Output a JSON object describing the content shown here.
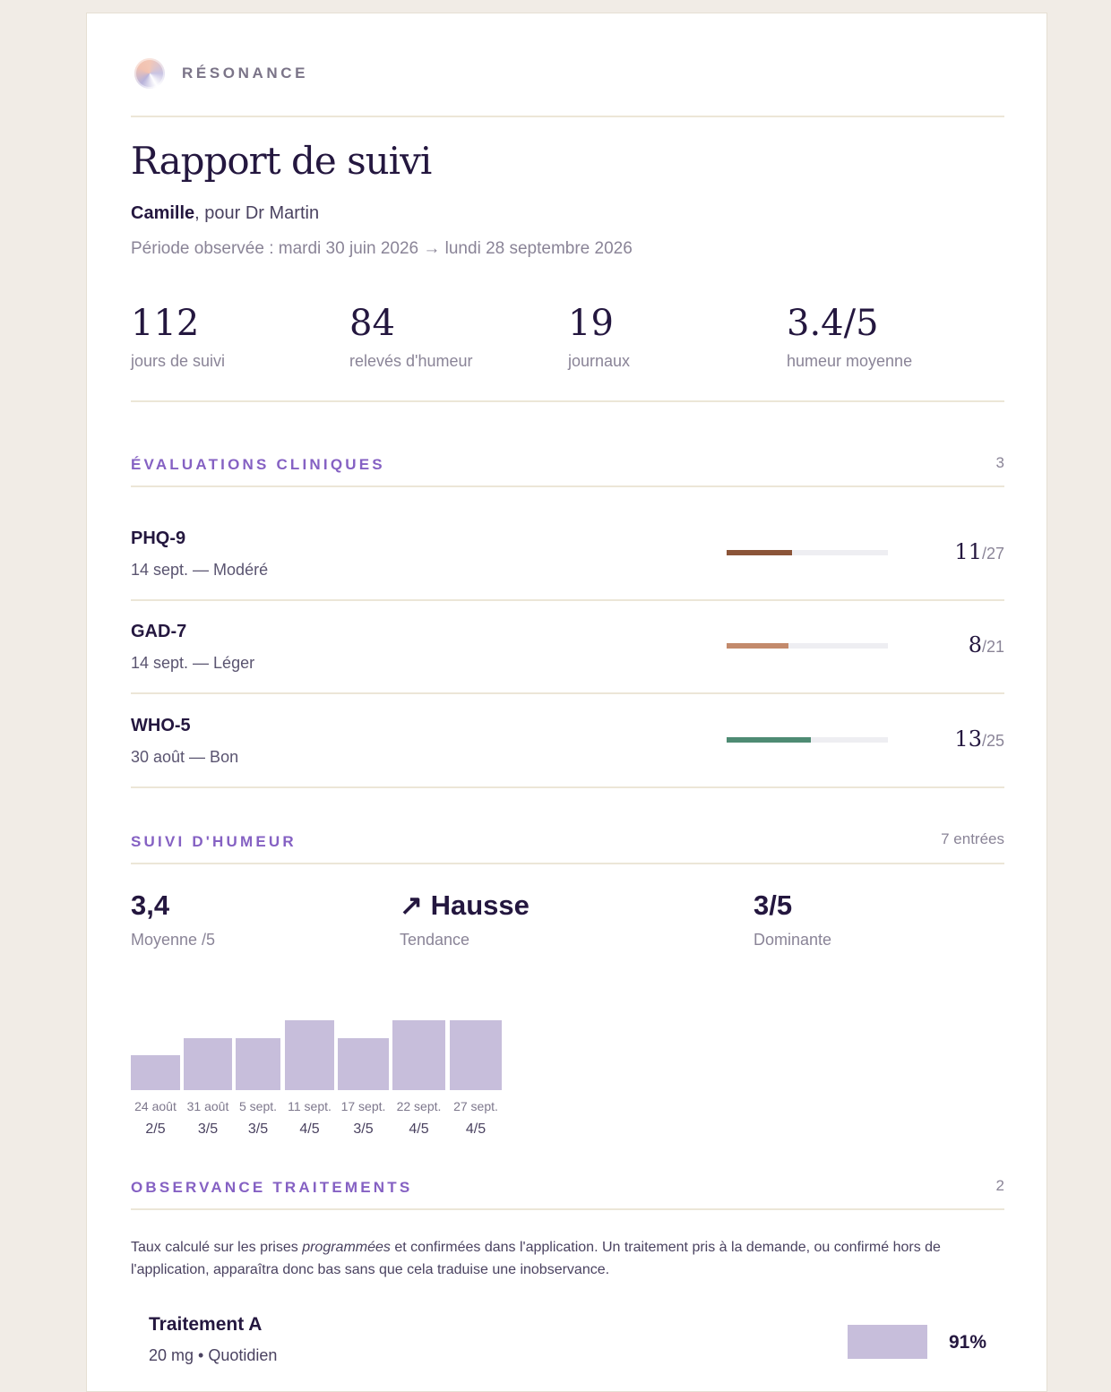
{
  "brand": {
    "name": "RÉSONANCE",
    "logo_icon": "orb-logo-icon"
  },
  "report": {
    "title": "Rapport de suivi",
    "patient": "Camille",
    "for": ", pour Dr Martin",
    "period": "Période observée : mardi 30 juin 2026 → lundi 28 septembre 2026"
  },
  "stats": [
    {
      "value": "112",
      "label": "jours de suivi"
    },
    {
      "value": "84",
      "label": "relevés d'humeur"
    },
    {
      "value": "19",
      "label": "journaux"
    },
    {
      "value": "3.4/5",
      "label": "humeur moyenne"
    }
  ],
  "evaluations": {
    "title": "ÉVALUATIONS CLINIQUES",
    "count": "3",
    "items": [
      {
        "name": "PHQ-9",
        "meta": "14 sept. — Modéré",
        "score": "11",
        "max": "/27",
        "fraction": 0.407,
        "color": "#8b5438"
      },
      {
        "name": "GAD-7",
        "meta": "14 sept. — Léger",
        "score": "8",
        "max": "/21",
        "fraction": 0.381,
        "color": "#c38a6c"
      },
      {
        "name": "WHO-5",
        "meta": "30 août — Bon",
        "score": "13",
        "max": "/25",
        "fraction": 0.52,
        "color": "#4e8b73"
      }
    ]
  },
  "mood": {
    "title": "SUIVI D'HUMEUR",
    "count": "7 entrées",
    "average": {
      "value": "3,4",
      "label": "Moyenne /5"
    },
    "trend": {
      "icon": "arrow-up-right-icon",
      "arrow": "↗",
      "value": "Hausse",
      "label": "Tendance"
    },
    "dominant": {
      "value": "3/5",
      "label": "Dominante"
    }
  },
  "chart_data": {
    "type": "bar",
    "categories": [
      "24 août",
      "31 août",
      "5 sept.",
      "11 sept.",
      "17 sept.",
      "22 sept.",
      "27 sept."
    ],
    "values": [
      2,
      3,
      3,
      4,
      3,
      4,
      4
    ],
    "value_labels": [
      "2/5",
      "3/5",
      "3/5",
      "4/5",
      "3/5",
      "4/5",
      "4/5"
    ],
    "ylim": [
      0,
      4
    ],
    "color": "#c7bedb"
  },
  "adherence": {
    "title": "OBSERVANCE TRAITEMENTS",
    "count": "2",
    "note_before": "Taux calculé sur les prises ",
    "note_em": "programmées",
    "note_after": " et confirmées dans l'application. Un traitement pris à la demande, ou confirmé hors de l'application, apparaîtra donc bas sans que cela traduise une inobservance.",
    "items": [
      {
        "name": "Traitement A",
        "meta": "20 mg • Quotidien",
        "pct": "91%",
        "fraction": 0.91
      }
    ]
  }
}
